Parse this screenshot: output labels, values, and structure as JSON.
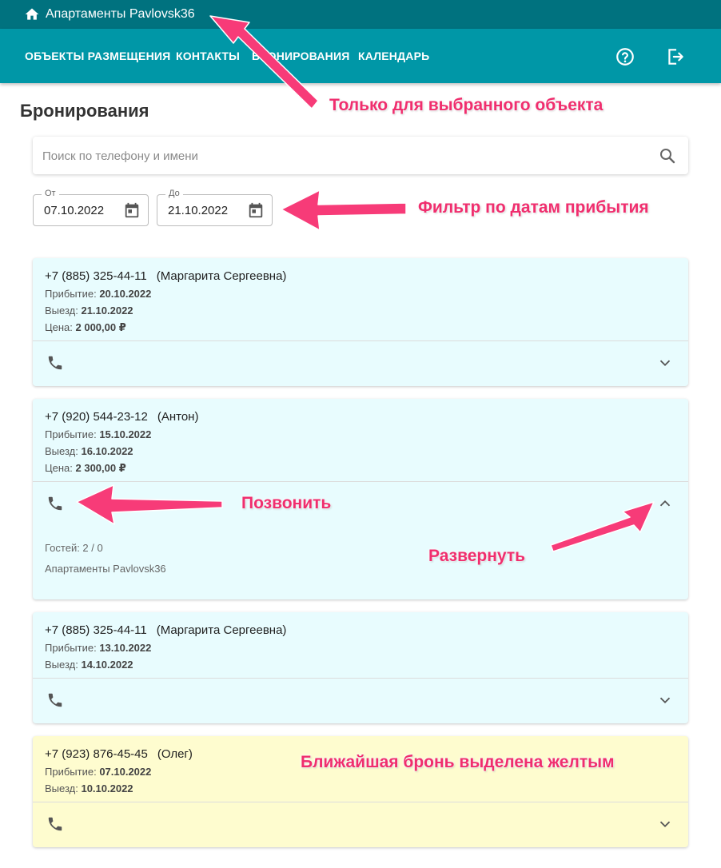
{
  "topbar": {
    "title": "Апартаменты Pavlovsk36"
  },
  "nav": {
    "items": [
      "ОБЪЕКТЫ РАЗМЕЩЕНИЯ",
      "КОНТАКТЫ",
      "БРОНИРОВАНИЯ",
      "КАЛЕНДАРЬ"
    ],
    "help_icon": "help-circle-icon",
    "logout_icon": "logout-icon"
  },
  "page": {
    "title": "Бронирования"
  },
  "search": {
    "placeholder": "Поиск по телефону и имени",
    "value": ""
  },
  "filter": {
    "from": {
      "label": "От",
      "value": "07.10.2022"
    },
    "to": {
      "label": "До",
      "value": "21.10.2022"
    }
  },
  "bookings": [
    {
      "phone": "+7 (885) 325-44-11",
      "name": "(Маргарита Сергеевна)",
      "arrival_label": "Прибытие:",
      "arrival": "20.10.2022",
      "departure_label": "Выезд:",
      "departure": "21.10.2022",
      "price_label": "Цена:",
      "price": "2 000,00 ₽"
    },
    {
      "phone": "+7 (920) 544-23-12",
      "name": "(Антон)",
      "arrival_label": "Прибытие:",
      "arrival": "15.10.2022",
      "departure_label": "Выезд:",
      "departure": "16.10.2022",
      "price_label": "Цена:",
      "price": "2 300,00 ₽",
      "guests": "Гостей: 2 / 0",
      "property": "Апартаменты Pavlovsk36"
    },
    {
      "phone": "+7 (885) 325-44-11",
      "name": "(Маргарита Сергеевна)",
      "arrival_label": "Прибытие:",
      "arrival": "13.10.2022",
      "departure_label": "Выезд:",
      "departure": "14.10.2022"
    },
    {
      "phone": "+7 (923) 876-45-45",
      "name": "(Олег)",
      "arrival_label": "Прибытие:",
      "arrival": "07.10.2022",
      "departure_label": "Выезд:",
      "departure": "10.10.2022"
    }
  ],
  "annotations": {
    "only_selected": "Только для выбранного объекта",
    "date_filter": "Фильтр по датам прибытия",
    "call": "Позвонить",
    "expand": "Развернуть",
    "nearest": "Ближайшая бронь выделена желтым"
  },
  "colors": {
    "topbar": "#00727f",
    "navbar": "#0097a7",
    "card": "#e8fcfe",
    "highlight": "#fefccf",
    "annotation": "#f02e6e"
  }
}
